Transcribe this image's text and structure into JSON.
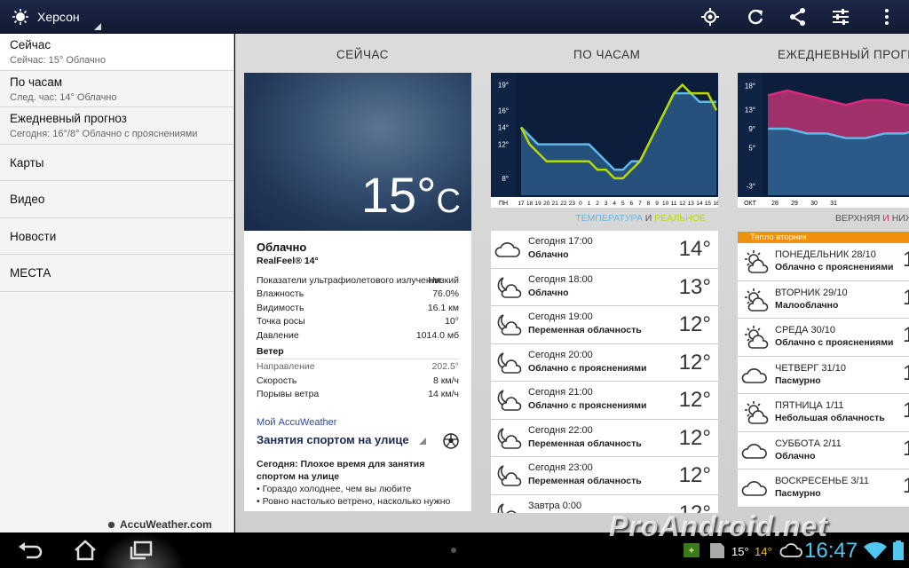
{
  "header": {
    "city": "Херсон"
  },
  "sidebar": {
    "items": [
      {
        "title": "Сейчас",
        "subtitle": "Сейчас: 15° Облачно"
      },
      {
        "title": "По часам",
        "subtitle": "След. час: 14° Облачно"
      },
      {
        "title": "Ежедневный прогноз",
        "subtitle": "Сегодня: 16°/8° Облачно с прояснениями"
      },
      {
        "title": "Карты"
      },
      {
        "title": "Видео"
      },
      {
        "title": "Новости"
      },
      {
        "title": "МЕСТА"
      }
    ],
    "brand": "AccuWeather.com"
  },
  "now": {
    "title": "СЕЙЧАС",
    "temp": "15°",
    "unit": "C",
    "condition": "Облачно",
    "realfeel": "RealFeel® 14°",
    "details": [
      {
        "label": "Показатели ультрафиолетового излучения",
        "value": "Низкий"
      },
      {
        "label": "Влажность",
        "value": "76.0%"
      },
      {
        "label": "Видимость",
        "value": "16.1 км"
      },
      {
        "label": "Точка росы",
        "value": "10°"
      },
      {
        "label": "Давление",
        "value": "1014.0 мб"
      }
    ],
    "wind_title": "Ветер",
    "wind": [
      {
        "label": "Направление",
        "value": "202.5°"
      },
      {
        "label": "Скорость",
        "value": "8 км/ч"
      },
      {
        "label": "Порывы ветра",
        "value": "14 км/ч"
      }
    ],
    "myaccu": "Мой AccuWeather",
    "activity": "Занятия спортом на улице",
    "advice_title": "Сегодня: Плохое время для занятия спортом на улице",
    "advice_1": "• Гораздо холоднее, чем вы любите",
    "advice_2": "• Ровно настолько ветрено, насколько нужно"
  },
  "hourly": {
    "title": "ПО ЧАСАМ",
    "legend_1": "ТЕМПЕРАТУРА",
    "legend_2": " И ",
    "legend_3": "РЕАЛЬНОЕ",
    "y_ticks": [
      "19°",
      "16°",
      "14°",
      "12°",
      "8°"
    ],
    "day_label": "ПН",
    "x_ticks": [
      "17",
      "18",
      "19",
      "20",
      "21",
      "22",
      "23",
      "0",
      "1",
      "2",
      "3",
      "4",
      "5",
      "6",
      "7",
      "8",
      "9",
      "10",
      "11",
      "12",
      "13",
      "14",
      "15",
      "16"
    ],
    "rows": [
      {
        "time": "Сегодня 17:00",
        "desc": "Облачно",
        "temp": "14°",
        "icon": "cloud-icon"
      },
      {
        "time": "Сегодня 18:00",
        "desc": "Облачно",
        "temp": "13°",
        "icon": "moon-cloud-icon"
      },
      {
        "time": "Сегодня 19:00",
        "desc": "Переменная облачность",
        "temp": "12°",
        "icon": "moon-cloud-icon"
      },
      {
        "time": "Сегодня 20:00",
        "desc": "Облачно с прояснениями",
        "temp": "12°",
        "icon": "moon-cloud-icon"
      },
      {
        "time": "Сегодня 21:00",
        "desc": "Облачно с прояснениями",
        "temp": "12°",
        "icon": "moon-cloud-icon"
      },
      {
        "time": "Сегодня 22:00",
        "desc": "Переменная облачность",
        "temp": "12°",
        "icon": "moon-cloud-icon"
      },
      {
        "time": "Сегодня 23:00",
        "desc": "Переменная облачность",
        "temp": "12°",
        "icon": "moon-cloud-icon"
      },
      {
        "time": "Завтра 0:00",
        "desc": "",
        "temp": "12°",
        "icon": "moon-cloud-icon"
      }
    ]
  },
  "daily": {
    "title": "ЕЖЕДНЕВНЫЙ ПРОГНОЗ",
    "legend_1": "ВЕРХНЯЯ",
    "legend_2": " И ",
    "legend_3": "НИЖНЯЯ",
    "y_ticks": [
      "18°",
      "13°",
      "9°",
      "5°",
      "-3°"
    ],
    "month_label": "ОКТ",
    "x_ticks": [
      "28",
      "29",
      "30",
      "31"
    ],
    "banner": "Тепло вторник",
    "rows": [
      {
        "day": "ПОНЕДЕЛЬНИК 28/10",
        "desc": "Облачно с прояснениями",
        "icon": "sun-cloud-icon"
      },
      {
        "day": "ВТОРНИК 29/10",
        "desc": "Малооблачно",
        "icon": "sun-cloud-icon"
      },
      {
        "day": "СРЕДА 30/10",
        "desc": "Облачно с прояснениями",
        "icon": "sun-cloud-icon"
      },
      {
        "day": "ЧЕТВЕРГ 31/10",
        "desc": "Пасмурно",
        "icon": "cloud-icon"
      },
      {
        "day": "ПЯТНИЦА 1/11",
        "desc": "Небольшая облачность",
        "icon": "sun-cloud-icon"
      },
      {
        "day": "СУББОТА 2/11",
        "desc": "Облачно",
        "icon": "cloud-icon"
      },
      {
        "day": "ВОСКРЕСЕНЬЕ 3/11",
        "desc": "Пасмурно",
        "icon": "cloud-icon"
      }
    ]
  },
  "status": {
    "temp": "15°",
    "temp2": "14°",
    "clock": "16:47"
  },
  "watermark": "ProAndroid.net",
  "colors": {
    "accent": "#5fb9e9",
    "realfeel": "#b9d800",
    "high": "#d82a7c",
    "banner": "#f09010",
    "clock": "#4fc7ef"
  },
  "chart_data": [
    {
      "type": "line",
      "title": "ПО ЧАСАМ",
      "x": [
        "17",
        "18",
        "19",
        "20",
        "21",
        "22",
        "23",
        "0",
        "1",
        "2",
        "3",
        "4",
        "5",
        "6",
        "7",
        "8",
        "9",
        "10",
        "11",
        "12",
        "13",
        "14",
        "15",
        "16"
      ],
      "ylim": [
        6,
        20
      ],
      "series": [
        {
          "name": "ТЕМПЕРАТУРА",
          "values": [
            14,
            13,
            12,
            12,
            12,
            12,
            12,
            12,
            12,
            11,
            10,
            9,
            9,
            10,
            10,
            12,
            14,
            16,
            18,
            18,
            18,
            17,
            17,
            17
          ]
        },
        {
          "name": "РЕАЛЬНОЕ",
          "values": [
            14,
            12,
            11,
            10,
            10,
            10,
            10,
            10,
            10,
            9,
            9,
            8,
            8,
            9,
            10,
            12,
            14,
            16,
            18,
            19,
            18,
            18,
            18,
            16
          ]
        }
      ]
    },
    {
      "type": "area",
      "title": "ЕЖЕДНЕВНЫЙ ПРОГНОЗ",
      "x": [
        "28",
        "29",
        "30",
        "31"
      ],
      "ylim": [
        -5,
        20
      ],
      "series": [
        {
          "name": "ВЕРХНЯЯ",
          "values": [
            16,
            17,
            16,
            15,
            14,
            15,
            15,
            14,
            14
          ]
        },
        {
          "name": "НИЖНЯЯ",
          "values": [
            9,
            9,
            8,
            8,
            7,
            7,
            8,
            8,
            9
          ]
        }
      ]
    }
  ]
}
